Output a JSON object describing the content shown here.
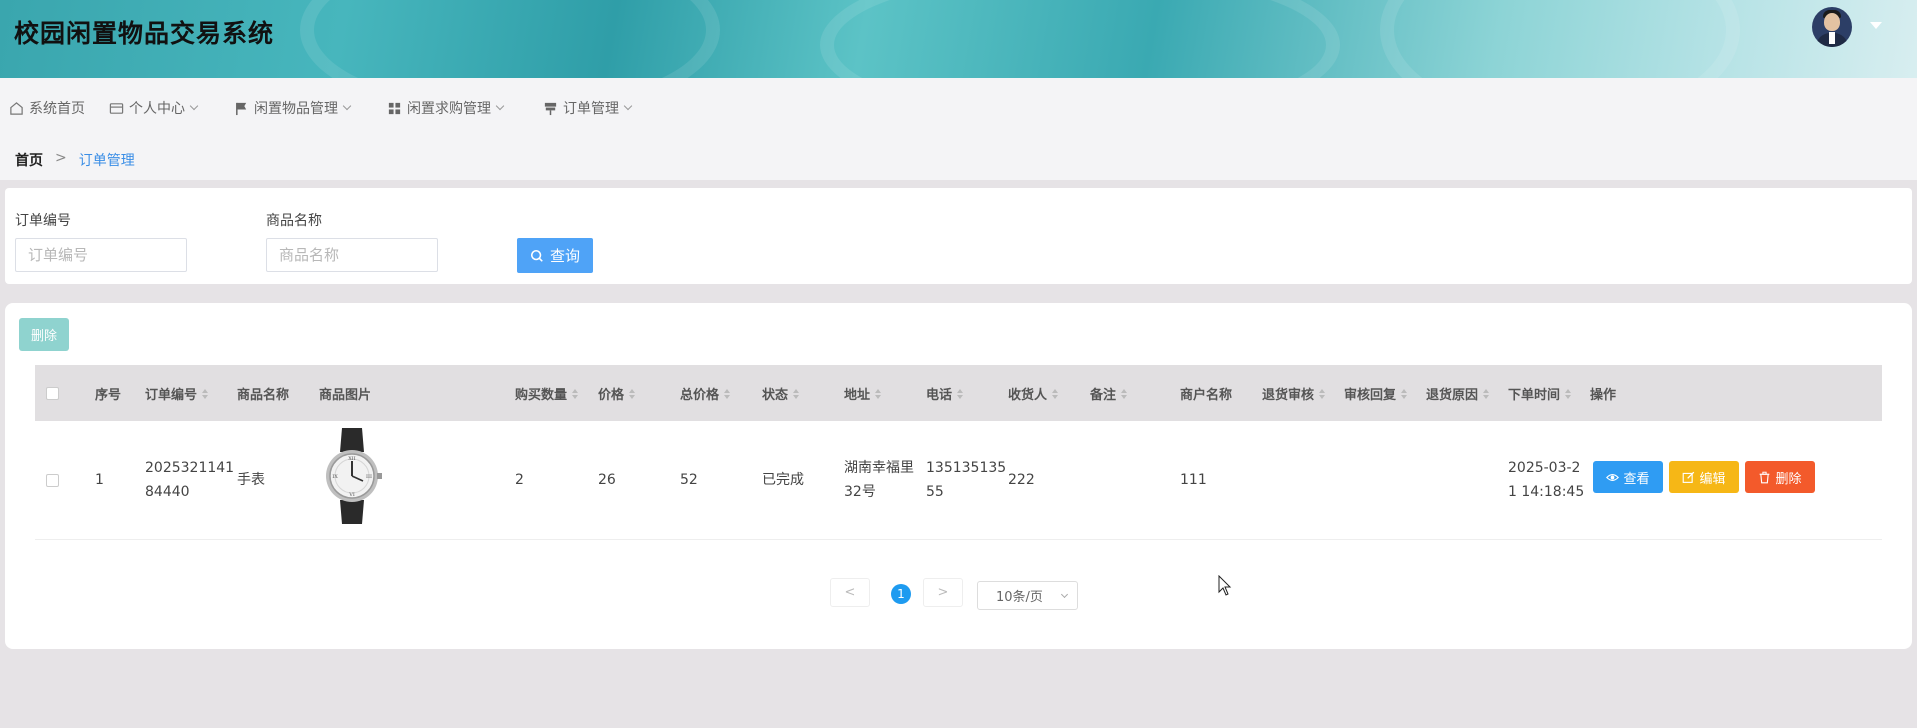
{
  "app": {
    "title": "校园闲置物品交易系统"
  },
  "nav": [
    {
      "label": "系统首页",
      "icon": "home-icon",
      "dropdown": false
    },
    {
      "label": "个人中心",
      "icon": "card-icon",
      "dropdown": true
    },
    {
      "label": "闲置物品管理",
      "icon": "flag-icon",
      "dropdown": true
    },
    {
      "label": "闲置求购管理",
      "icon": "grid-icon",
      "dropdown": true
    },
    {
      "label": "订单管理",
      "icon": "sign-icon",
      "dropdown": true
    }
  ],
  "breadcrumb": {
    "home": "首页",
    "separator": ">",
    "current": "订单管理"
  },
  "search": {
    "order_no_label": "订单编号",
    "order_no_placeholder": "订单编号",
    "order_no_value": "",
    "product_label": "商品名称",
    "product_placeholder": "商品名称",
    "product_value": "",
    "query_label": "查询"
  },
  "toolbar": {
    "delete_label": "删除"
  },
  "table": {
    "headers": [
      "序号",
      "订单编号",
      "商品名称",
      "商品图片",
      "购买数量",
      "价格",
      "总价格",
      "状态",
      "地址",
      "电话",
      "收货人",
      "备注",
      "商户名称",
      "退货审核",
      "审核回复",
      "退货原因",
      "下单时间",
      "操作"
    ],
    "rows": [
      {
        "index": "1",
        "order_no_line1": "2025321141",
        "order_no_line2": "84440",
        "product": "手表",
        "image": "wristwatch",
        "quantity": "2",
        "price": "26",
        "total": "52",
        "status": "已完成",
        "address_line1": "湖南幸福里",
        "address_line2": "32号",
        "phone_line1": "135135135",
        "phone_line2": "55",
        "receiver": "222",
        "remark": "",
        "merchant": "111",
        "return_review": "",
        "review_reply": "",
        "return_reason": "",
        "time_line1": "2025-03-2",
        "time_line2": "1 14:18:45"
      }
    ],
    "actions": {
      "view": "查看",
      "edit": "编辑",
      "delete": "删除"
    }
  },
  "pagination": {
    "prev": "<",
    "next": ">",
    "current_page": "1",
    "page_size": "10条/页"
  },
  "colors": {
    "primary": "#2f9cf3",
    "warning": "#f6b716",
    "danger": "#f35a2b",
    "link": "#3a8ee6"
  }
}
